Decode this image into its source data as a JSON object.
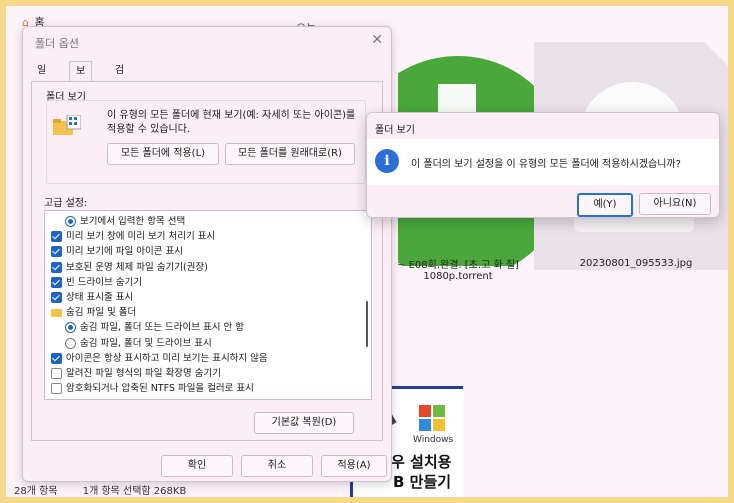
{
  "explorer": {
    "breadcrumb_home": "홈",
    "top_fragment": "오늘",
    "files": [
      {
        "name_line1": "~ E08회.완결. [초.고 화 질]",
        "name_line2": "1080p.torrent"
      },
      {
        "name": "20230801_095533.jpg"
      }
    ],
    "win_tile": {
      "brand": "Windows",
      "line1": "우 설치용",
      "line2": "B 만들기"
    },
    "status": {
      "count": "28개 항목",
      "selected": "1개 항목 선택함 268KB"
    }
  },
  "folder_options": {
    "title": "폴더 옵션",
    "tabs": [
      "일반",
      "보기",
      "검색"
    ],
    "active_tab": 1,
    "folder_view_label": "폴더 보기",
    "folder_view_desc": "이 유형의 모든 폴더에 현재 보기(예: 자세히 또는 아이콘)를 적용할 수 있습니다.",
    "apply_to_folders": "모든 폴더에 적용(L)",
    "reset_folders": "모든 폴더를 원래대로(R)",
    "advanced_label": "고급 설정:",
    "settings": [
      {
        "type": "radio",
        "checked": true,
        "indent": 2,
        "label": "보기에서 입력한 항목 선택"
      },
      {
        "type": "check",
        "checked": true,
        "indent": 1,
        "label": "미리 보기 창에 미리 보기 처리기 표시"
      },
      {
        "type": "check",
        "checked": true,
        "indent": 1,
        "label": "미리 보기에 파일 아이콘 표시"
      },
      {
        "type": "check",
        "checked": true,
        "indent": 1,
        "label": "보호된 운영 체제 파일 숨기기(권장)"
      },
      {
        "type": "check",
        "checked": true,
        "indent": 1,
        "label": "빈 드라이브 숨기기"
      },
      {
        "type": "check",
        "checked": true,
        "indent": 1,
        "label": "상태 표시줄 표시"
      },
      {
        "type": "folder",
        "checked": false,
        "indent": 1,
        "label": "숨김 파일 및 폴더"
      },
      {
        "type": "radio",
        "checked": true,
        "indent": 2,
        "label": "숨김 파일, 폴더 또는 드라이브 표시 안 함"
      },
      {
        "type": "radio",
        "checked": false,
        "indent": 2,
        "label": "숨김 파일, 폴더 및 드라이브 표시"
      },
      {
        "type": "check",
        "checked": true,
        "indent": 1,
        "label": "아이콘은 항상 표시하고 미리 보기는 표시하지 않음"
      },
      {
        "type": "check",
        "checked": false,
        "indent": 1,
        "label": "알려진 파일 형식의 파일 확장명 숨기기"
      },
      {
        "type": "check",
        "checked": false,
        "indent": 1,
        "label": "암호화되거나 압축된 NTFS 파일을 컬러로 표시"
      }
    ],
    "restore_defaults": "기본값 복원(D)",
    "ok": "확인",
    "cancel": "취소",
    "apply": "적용(A)"
  },
  "confirm_dialog": {
    "title": "폴더 보기",
    "message": "이 폴더의 보기 설정을 이 유형의 모든 폴더에 적용하시겠습니까?",
    "yes": "예(Y)",
    "no": "아니요(N)",
    "icon": "info-icon"
  },
  "colors": {
    "accent": "#2a6ed6",
    "page_border": "#f6d98a",
    "folder_yellow": "#f4c24a",
    "torrent_green": "#4aa83a"
  }
}
